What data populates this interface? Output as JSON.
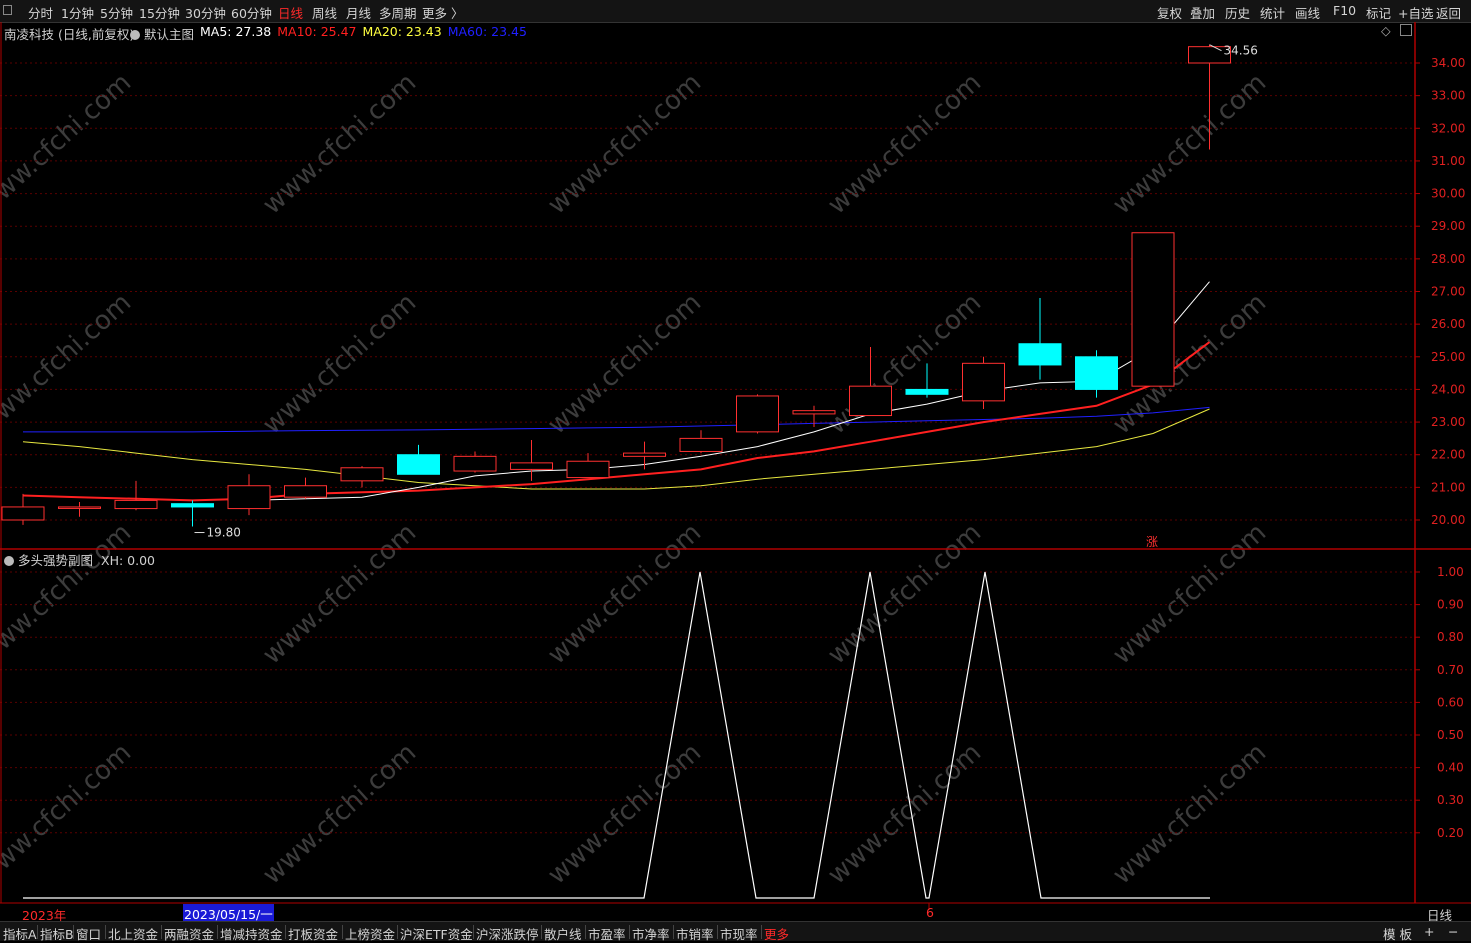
{
  "toolbar": {
    "periods": [
      "分时",
      "1分钟",
      "5分钟",
      "15分钟",
      "30分钟",
      "60分钟",
      "日线",
      "周线",
      "月线",
      "多周期",
      "更多 〉"
    ],
    "active_period": "日线",
    "right_buttons": [
      "复权",
      "叠加",
      "历史",
      "统计",
      "画线",
      "F10",
      "标记",
      "+自选",
      "返回"
    ]
  },
  "main_chart": {
    "stock_title": "南凌科技 (日线,前复权)",
    "template_label": "默认主图",
    "ma_legend": [
      {
        "label": "MA5: 27.38",
        "color": "#ffffff"
      },
      {
        "label": "MA10: 25.47",
        "color": "#ff2020"
      },
      {
        "label": "MA20: 23.43",
        "color": "#ffff40"
      },
      {
        "label": "MA60: 23.45",
        "color": "#2020ff"
      }
    ],
    "high_label": "34.56",
    "low_label": "19.80",
    "zhang_marker": "涨"
  },
  "sub_chart": {
    "title": "多头强势副图",
    "value_label": "XH: 0.00"
  },
  "date_axis": {
    "year_label": "2023年",
    "cursor_date": "2023/05/15/一",
    "month_label": "6",
    "period_label": "日线"
  },
  "bottom_tabs": [
    "指标A",
    "指标B",
    "窗口",
    "北上资金",
    "两融资金",
    "增减持资金",
    "打板资金",
    "上榜资金",
    "沪深ETF资金",
    "沪深涨跌停",
    "散户线",
    "市盈率",
    "市净率",
    "市销率",
    "市现率",
    "更多"
  ],
  "bottom_active": "更多",
  "bottom_right": [
    "模 板",
    "+",
    "−"
  ],
  "watermark": "www.cfchi.com",
  "chart_data": [
    {
      "type": "candlestick",
      "price_axis": {
        "min": 20,
        "max": 34,
        "ticks": [
          "20.00",
          "21.00",
          "22.00",
          "23.00",
          "24.00",
          "25.00",
          "26.00",
          "27.00",
          "28.00",
          "29.00",
          "30.00",
          "31.00",
          "32.00",
          "33.00",
          "34.00"
        ]
      },
      "candles": [
        {
          "o": 20.0,
          "c": 20.4,
          "h": 20.8,
          "l": 19.85
        },
        {
          "o": 20.4,
          "c": 20.4,
          "h": 20.55,
          "l": 20.1
        },
        {
          "o": 20.35,
          "c": 20.6,
          "h": 21.2,
          "l": 20.3
        },
        {
          "o": 20.5,
          "c": 20.4,
          "h": 20.6,
          "l": 19.8
        },
        {
          "o": 20.35,
          "c": 21.05,
          "h": 21.4,
          "l": 20.15
        },
        {
          "o": 20.7,
          "c": 21.05,
          "h": 21.3,
          "l": 20.65
        },
        {
          "o": 21.2,
          "c": 21.6,
          "h": 21.65,
          "l": 21.0
        },
        {
          "o": 22.0,
          "c": 21.4,
          "h": 22.3,
          "l": 21.4
        },
        {
          "o": 21.5,
          "c": 21.95,
          "h": 22.1,
          "l": 21.45
        },
        {
          "o": 21.55,
          "c": 21.75,
          "h": 22.45,
          "l": 21.2
        },
        {
          "o": 21.3,
          "c": 21.8,
          "h": 22.05,
          "l": 21.3
        },
        {
          "o": 21.95,
          "c": 22.05,
          "h": 22.4,
          "l": 21.55
        },
        {
          "o": 22.1,
          "c": 22.5,
          "h": 22.75,
          "l": 22.05
        },
        {
          "o": 22.7,
          "c": 23.8,
          "h": 23.85,
          "l": 22.65
        },
        {
          "o": 23.25,
          "c": 23.35,
          "h": 23.5,
          "l": 22.85
        },
        {
          "o": 23.2,
          "c": 24.1,
          "h": 25.3,
          "l": 23.2
        },
        {
          "o": 24.0,
          "c": 23.85,
          "h": 24.8,
          "l": 23.75
        },
        {
          "o": 23.65,
          "c": 24.8,
          "h": 25.0,
          "l": 23.4
        },
        {
          "o": 25.4,
          "c": 24.75,
          "h": 26.8,
          "l": 24.3
        },
        {
          "o": 25.0,
          "c": 24.0,
          "h": 25.2,
          "l": 23.75
        },
        {
          "o": 24.1,
          "c": 28.8,
          "h": 28.8,
          "l": 24.1
        },
        {
          "o": 34.0,
          "c": 34.5,
          "h": 34.56,
          "l": 31.35
        }
      ],
      "ma5": [
        null,
        null,
        null,
        null,
        20.6,
        20.65,
        20.7,
        21.0,
        21.35,
        21.5,
        21.55,
        21.7,
        21.95,
        22.25,
        22.7,
        23.25,
        23.55,
        23.95,
        24.2,
        24.25,
        25.25,
        27.3
      ],
      "ma10": [
        20.75,
        20.7,
        20.65,
        20.6,
        20.65,
        20.8,
        20.85,
        20.9,
        21.0,
        21.1,
        21.25,
        21.4,
        21.55,
        21.9,
        22.1,
        22.4,
        22.7,
        23.0,
        23.25,
        23.5,
        24.15,
        25.45
      ],
      "ma20": [
        22.4,
        22.25,
        22.05,
        21.85,
        21.7,
        21.55,
        21.35,
        21.15,
        21.05,
        20.95,
        20.95,
        20.95,
        21.05,
        21.25,
        21.4,
        21.55,
        21.7,
        21.85,
        22.05,
        22.25,
        22.65,
        23.4
      ],
      "ma60": [
        22.7,
        22.7,
        22.7,
        22.7,
        22.72,
        22.74,
        22.75,
        22.76,
        22.78,
        22.8,
        22.82,
        22.84,
        22.88,
        22.92,
        22.96,
        23.0,
        23.04,
        23.08,
        23.12,
        23.18,
        23.28,
        23.45
      ]
    },
    {
      "type": "line",
      "series_name": "XH",
      "y_axis": {
        "min": 0,
        "max": 1,
        "ticks": [
          "0.20",
          "0.30",
          "0.40",
          "0.50",
          "0.60",
          "0.70",
          "0.80",
          "0.90",
          "1.00"
        ]
      },
      "values": [
        0,
        0,
        0,
        0,
        0,
        0,
        0,
        0,
        0,
        0,
        0,
        0,
        1,
        0,
        0,
        1,
        0,
        1,
        0,
        0,
        0,
        0
      ]
    }
  ]
}
